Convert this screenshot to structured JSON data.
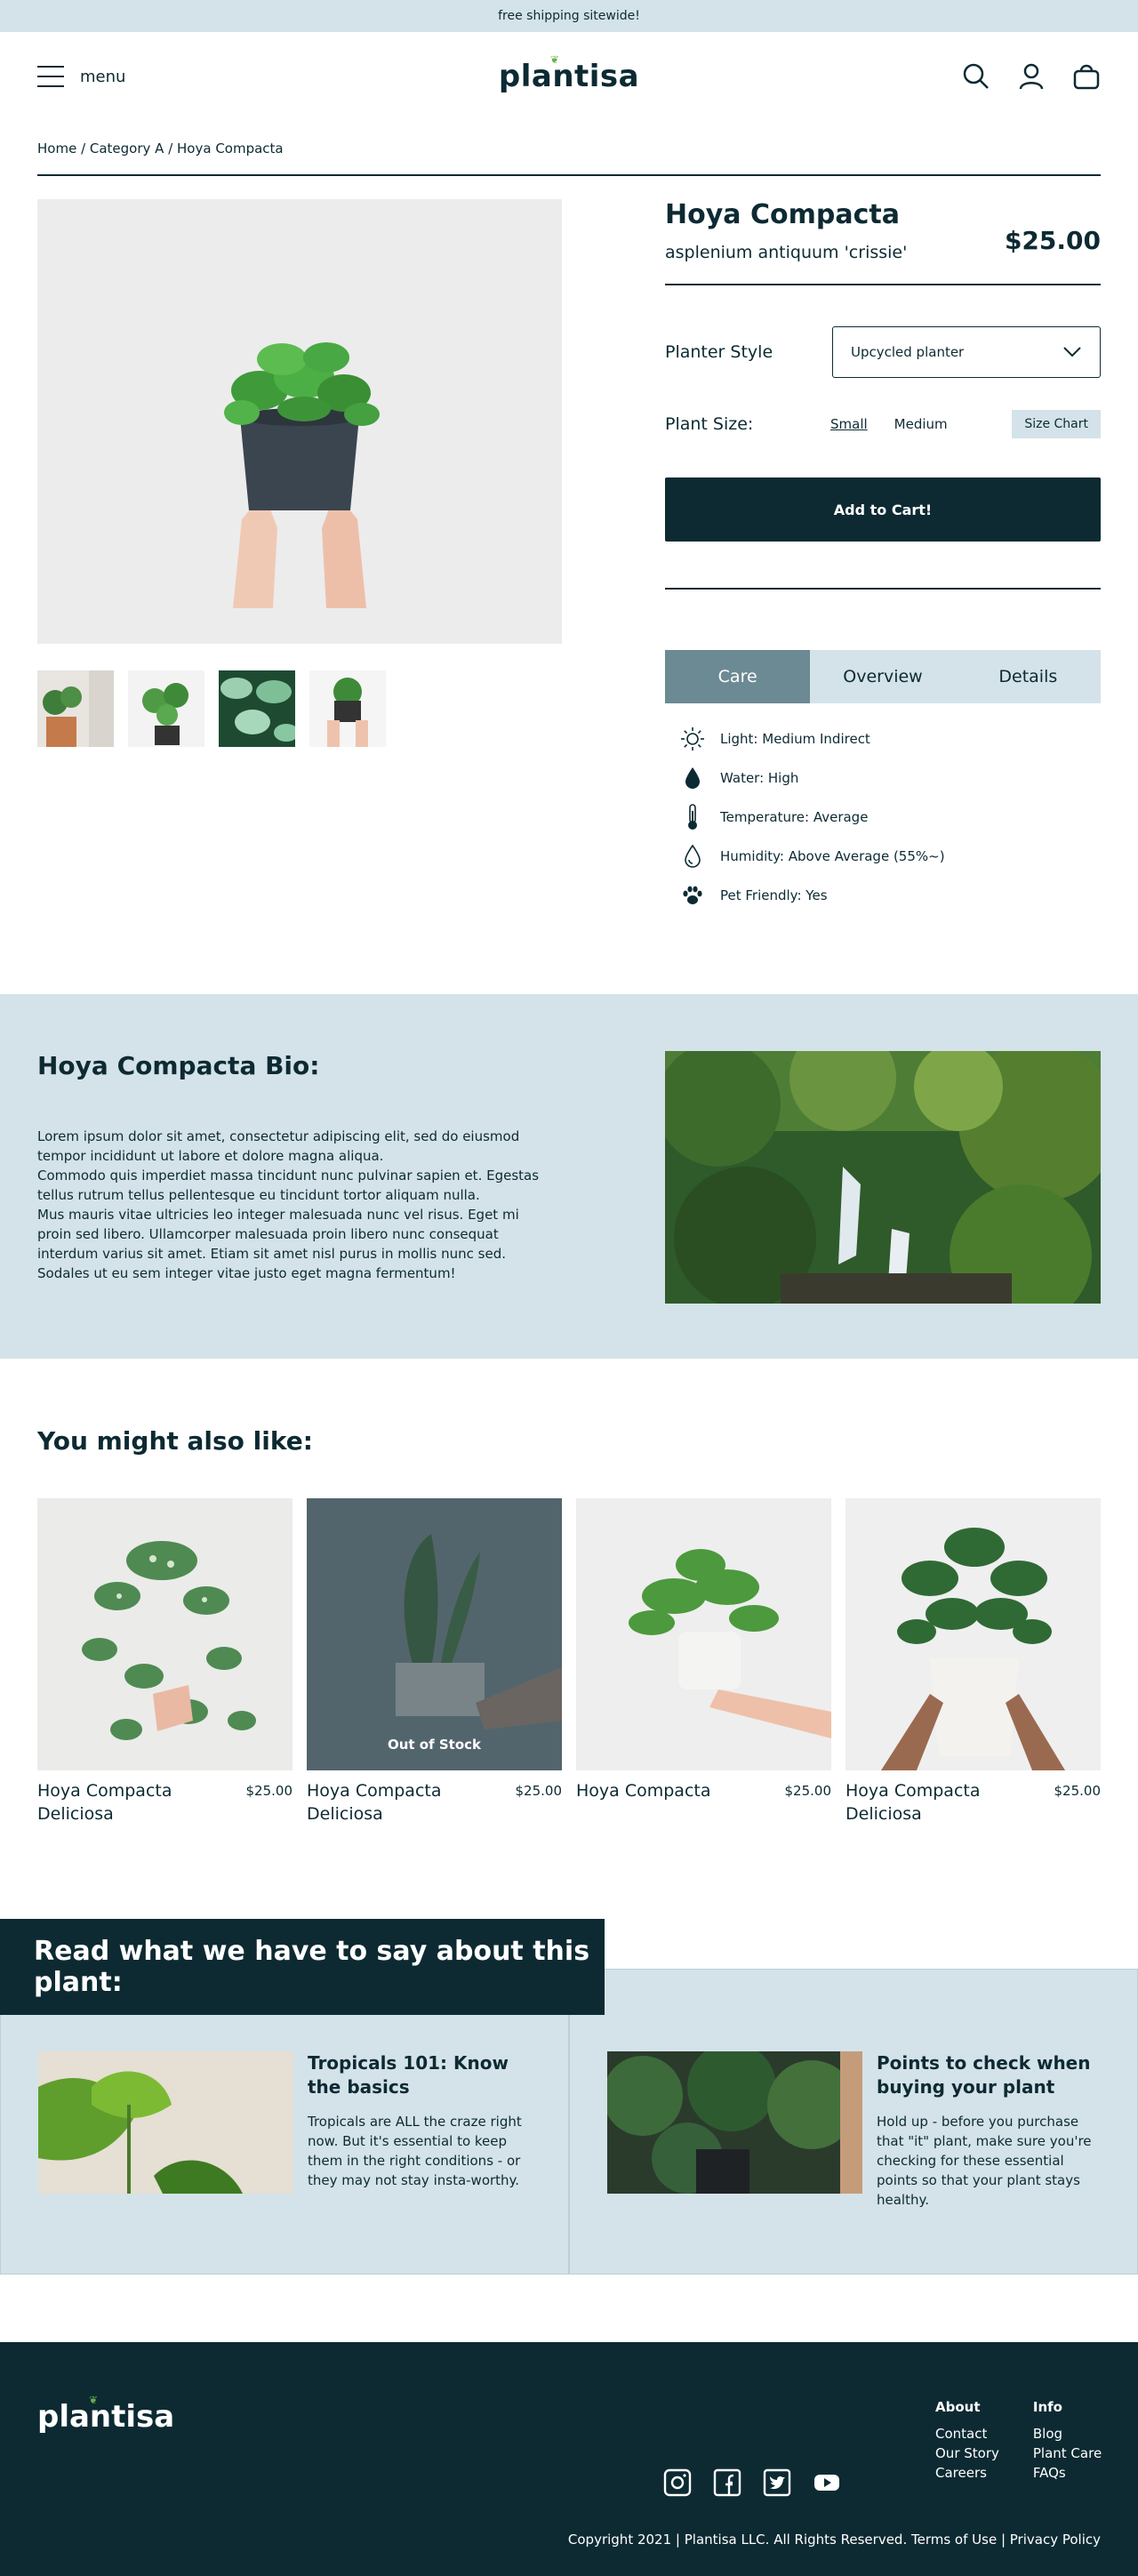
{
  "announcement": "free shipping sitewide!",
  "header": {
    "menu_label": "menu",
    "logo": "plantisa",
    "icons": [
      "search-icon",
      "account-icon",
      "bag-icon"
    ]
  },
  "breadcrumb": "Home / Category A / Hoya Compacta",
  "product": {
    "title": "Hoya Compacta",
    "subtitle": "asplenium antiquum 'crissie'",
    "price": "$25.00",
    "planter_label": "Planter Style",
    "planter_value": "Upcycled planter",
    "size_label": "Plant Size:",
    "sizes": [
      "Small",
      "Medium"
    ],
    "selected_size": "Small",
    "size_chart": "Size Chart",
    "cart_label": "Add to Cart!"
  },
  "tabs": [
    "Care",
    "Overview",
    "Details"
  ],
  "active_tab": "Care",
  "care": [
    {
      "icon": "sun-icon",
      "text": "Light: Medium Indirect"
    },
    {
      "icon": "water-drop-icon",
      "text": "Water: High"
    },
    {
      "icon": "thermometer-icon",
      "text": "Temperature: Average"
    },
    {
      "icon": "humidity-icon",
      "text": "Humidity: Above Average (55%~)"
    },
    {
      "icon": "paw-icon",
      "text": "Pet Friendly: Yes"
    }
  ],
  "bio": {
    "title": "Hoya Compacta Bio:",
    "body": "Lorem ipsum dolor sit amet, consectetur adipiscing elit, sed do eiusmod tempor incididunt ut labore et dolore magna aliqua.\nCommodo quis imperdiet massa tincidunt nunc pulvinar sapien et. Egestas tellus rutrum tellus pellentesque eu tincidunt tortor aliquam nulla.\nMus mauris vitae ultricies leo integer malesuada nunc vel risus. Eget mi proin sed libero. Ullamcorper malesuada proin libero nunc consequat interdum varius sit amet. Etiam sit amet nisl purus in mollis nunc sed. Sodales ut eu sem integer vitae justo eget magna fermentum!"
  },
  "also": {
    "title": "You might also like:",
    "items": [
      {
        "name": "Hoya Compacta Deliciosa",
        "price": "$25.00",
        "status": ""
      },
      {
        "name": "Hoya Compacta Deliciosa",
        "price": "$25.00",
        "status": "Out of Stock"
      },
      {
        "name": "Hoya Compacta",
        "price": "$25.00",
        "status": ""
      },
      {
        "name": "Hoya Compacta Deliciosa",
        "price": "$25.00",
        "status": ""
      }
    ]
  },
  "articles": {
    "banner": "Read what we have to say about this plant:",
    "items": [
      {
        "title": "Tropicals 101: Know the basics",
        "body": "Tropicals are ALL the craze right now. But it's essential to keep them in the right conditions - or they may not stay insta-worthy."
      },
      {
        "title": "Points to check when buying your plant",
        "body": "Hold up - before you purchase that \"it\" plant, make sure you're checking for these essential points so that your plant stays healthy."
      }
    ]
  },
  "footer": {
    "logo": "plantisa",
    "about": {
      "heading": "About",
      "links": [
        "Contact",
        "Our Story",
        "Careers"
      ]
    },
    "info": {
      "heading": "Info",
      "links": [
        "Blog",
        "Plant Care",
        "FAQs"
      ]
    },
    "socials": [
      "instagram-icon",
      "facebook-icon",
      "twitter-icon",
      "youtube-icon"
    ],
    "copyright": "Copyright 2021 | Plantisa LLC. All Rights Reserved. Terms of Use | Privacy Policy"
  },
  "colors": {
    "dark": "#0d2a33",
    "light": "#d4e3e9",
    "tab_active": "#6c8a93",
    "leaf": "#6ab04c"
  }
}
